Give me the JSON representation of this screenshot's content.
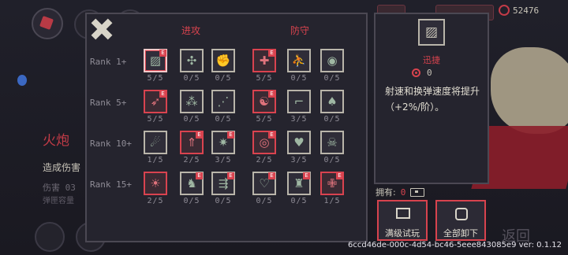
{
  "background": {
    "weapon_name": "火炮",
    "damage_desc": "造成伤害",
    "damage_label": "伤害",
    "damage_value": "03",
    "ammo_label": "弹匣容量",
    "currency_value": "52476",
    "return_label": "返回"
  },
  "talents": {
    "attack_header": "进攻",
    "defense_header": "防守",
    "ranks": [
      {
        "label": "Rank 1+",
        "cells": [
          {
            "icon": "diagonal-lines-icon",
            "glyph": "▨",
            "count": "5/5",
            "red": false,
            "e": true,
            "selected": true
          },
          {
            "icon": "spin-blade-icon",
            "glyph": "✣",
            "count": "0/5",
            "red": false,
            "e": false
          },
          {
            "icon": "fist-icon",
            "glyph": "✊",
            "count": "0/5",
            "red": false,
            "e": false
          },
          {
            "icon": "shield-cross-icon",
            "glyph": "✚",
            "count": "5/5",
            "red": true,
            "e": true
          },
          {
            "icon": "runner-icon",
            "glyph": "⛹",
            "count": "0/5",
            "red": false,
            "e": false
          },
          {
            "icon": "eye-shield-icon",
            "glyph": "◉",
            "count": "0/5",
            "red": false,
            "e": false
          }
        ]
      },
      {
        "label": "Rank 5+",
        "cells": [
          {
            "icon": "arrow-crossbow-icon",
            "glyph": "➶",
            "count": "5/5",
            "red": true,
            "e": true
          },
          {
            "icon": "bullet-spread-icon",
            "glyph": "⁂",
            "count": "0/5",
            "red": false,
            "e": false
          },
          {
            "icon": "bullet-stream-icon",
            "glyph": "⋰",
            "count": "0/5",
            "red": false,
            "e": false
          },
          {
            "icon": "swirl-shield-icon",
            "glyph": "☯",
            "count": "5/5",
            "red": true,
            "e": true
          },
          {
            "icon": "boot-icon",
            "glyph": "⌐",
            "count": "3/5",
            "red": false,
            "e": false
          },
          {
            "icon": "leaf-shield-icon",
            "glyph": "♠",
            "count": "0/5",
            "red": false,
            "e": false
          }
        ]
      },
      {
        "label": "Rank 10+",
        "cells": [
          {
            "icon": "bomb-icon",
            "glyph": "☄",
            "count": "1/5",
            "red": false,
            "e": false
          },
          {
            "icon": "split-arrow-icon",
            "glyph": "⇑",
            "count": "2/5",
            "red": true,
            "e": true
          },
          {
            "icon": "burst-icon",
            "glyph": "✷",
            "count": "3/5",
            "red": false,
            "e": true
          },
          {
            "icon": "orb-shield-icon",
            "glyph": "◎",
            "count": "2/5",
            "red": true,
            "e": true
          },
          {
            "icon": "hearts-icon",
            "glyph": "♥",
            "count": "3/5",
            "red": false,
            "e": false
          },
          {
            "icon": "reaper-icon",
            "glyph": "☠",
            "count": "0/5",
            "red": false,
            "e": false
          }
        ]
      },
      {
        "label": "Rank 15+",
        "cells": [
          {
            "icon": "fireball-icon",
            "glyph": "☀",
            "count": "2/5",
            "red": true,
            "e": false
          },
          {
            "icon": "demon-icon",
            "glyph": "♞",
            "count": "0/5",
            "red": false,
            "e": true
          },
          {
            "icon": "triple-arrow-icon",
            "glyph": "⇶",
            "count": "0/5",
            "red": false,
            "e": true
          },
          {
            "icon": "heart-cross-icon",
            "glyph": "♡",
            "count": "0/5",
            "red": false,
            "e": true
          },
          {
            "icon": "wing-guard-icon",
            "glyph": "♜",
            "count": "0/5",
            "red": false,
            "e": true
          },
          {
            "icon": "medic-icon",
            "glyph": "✙",
            "count": "1/5",
            "red": true,
            "e": true
          }
        ]
      }
    ]
  },
  "detail": {
    "icon": "diagonal-lines-icon",
    "glyph": "▨",
    "name": "迅捷",
    "cost": "0",
    "description": "射速和换弹速度将提升（+2%/阶）。"
  },
  "owned": {
    "label": "拥有:",
    "value": "0"
  },
  "buttons": {
    "trial": "满级试玩",
    "remove": "全部卸下"
  },
  "footer": {
    "version": "6ccd46de-000c-4d54-bc46-5eee843085e9 ver: 0.1.12"
  },
  "colors": {
    "accent": "#d8434e",
    "panel": "#25242e",
    "border": "#4b4853"
  }
}
